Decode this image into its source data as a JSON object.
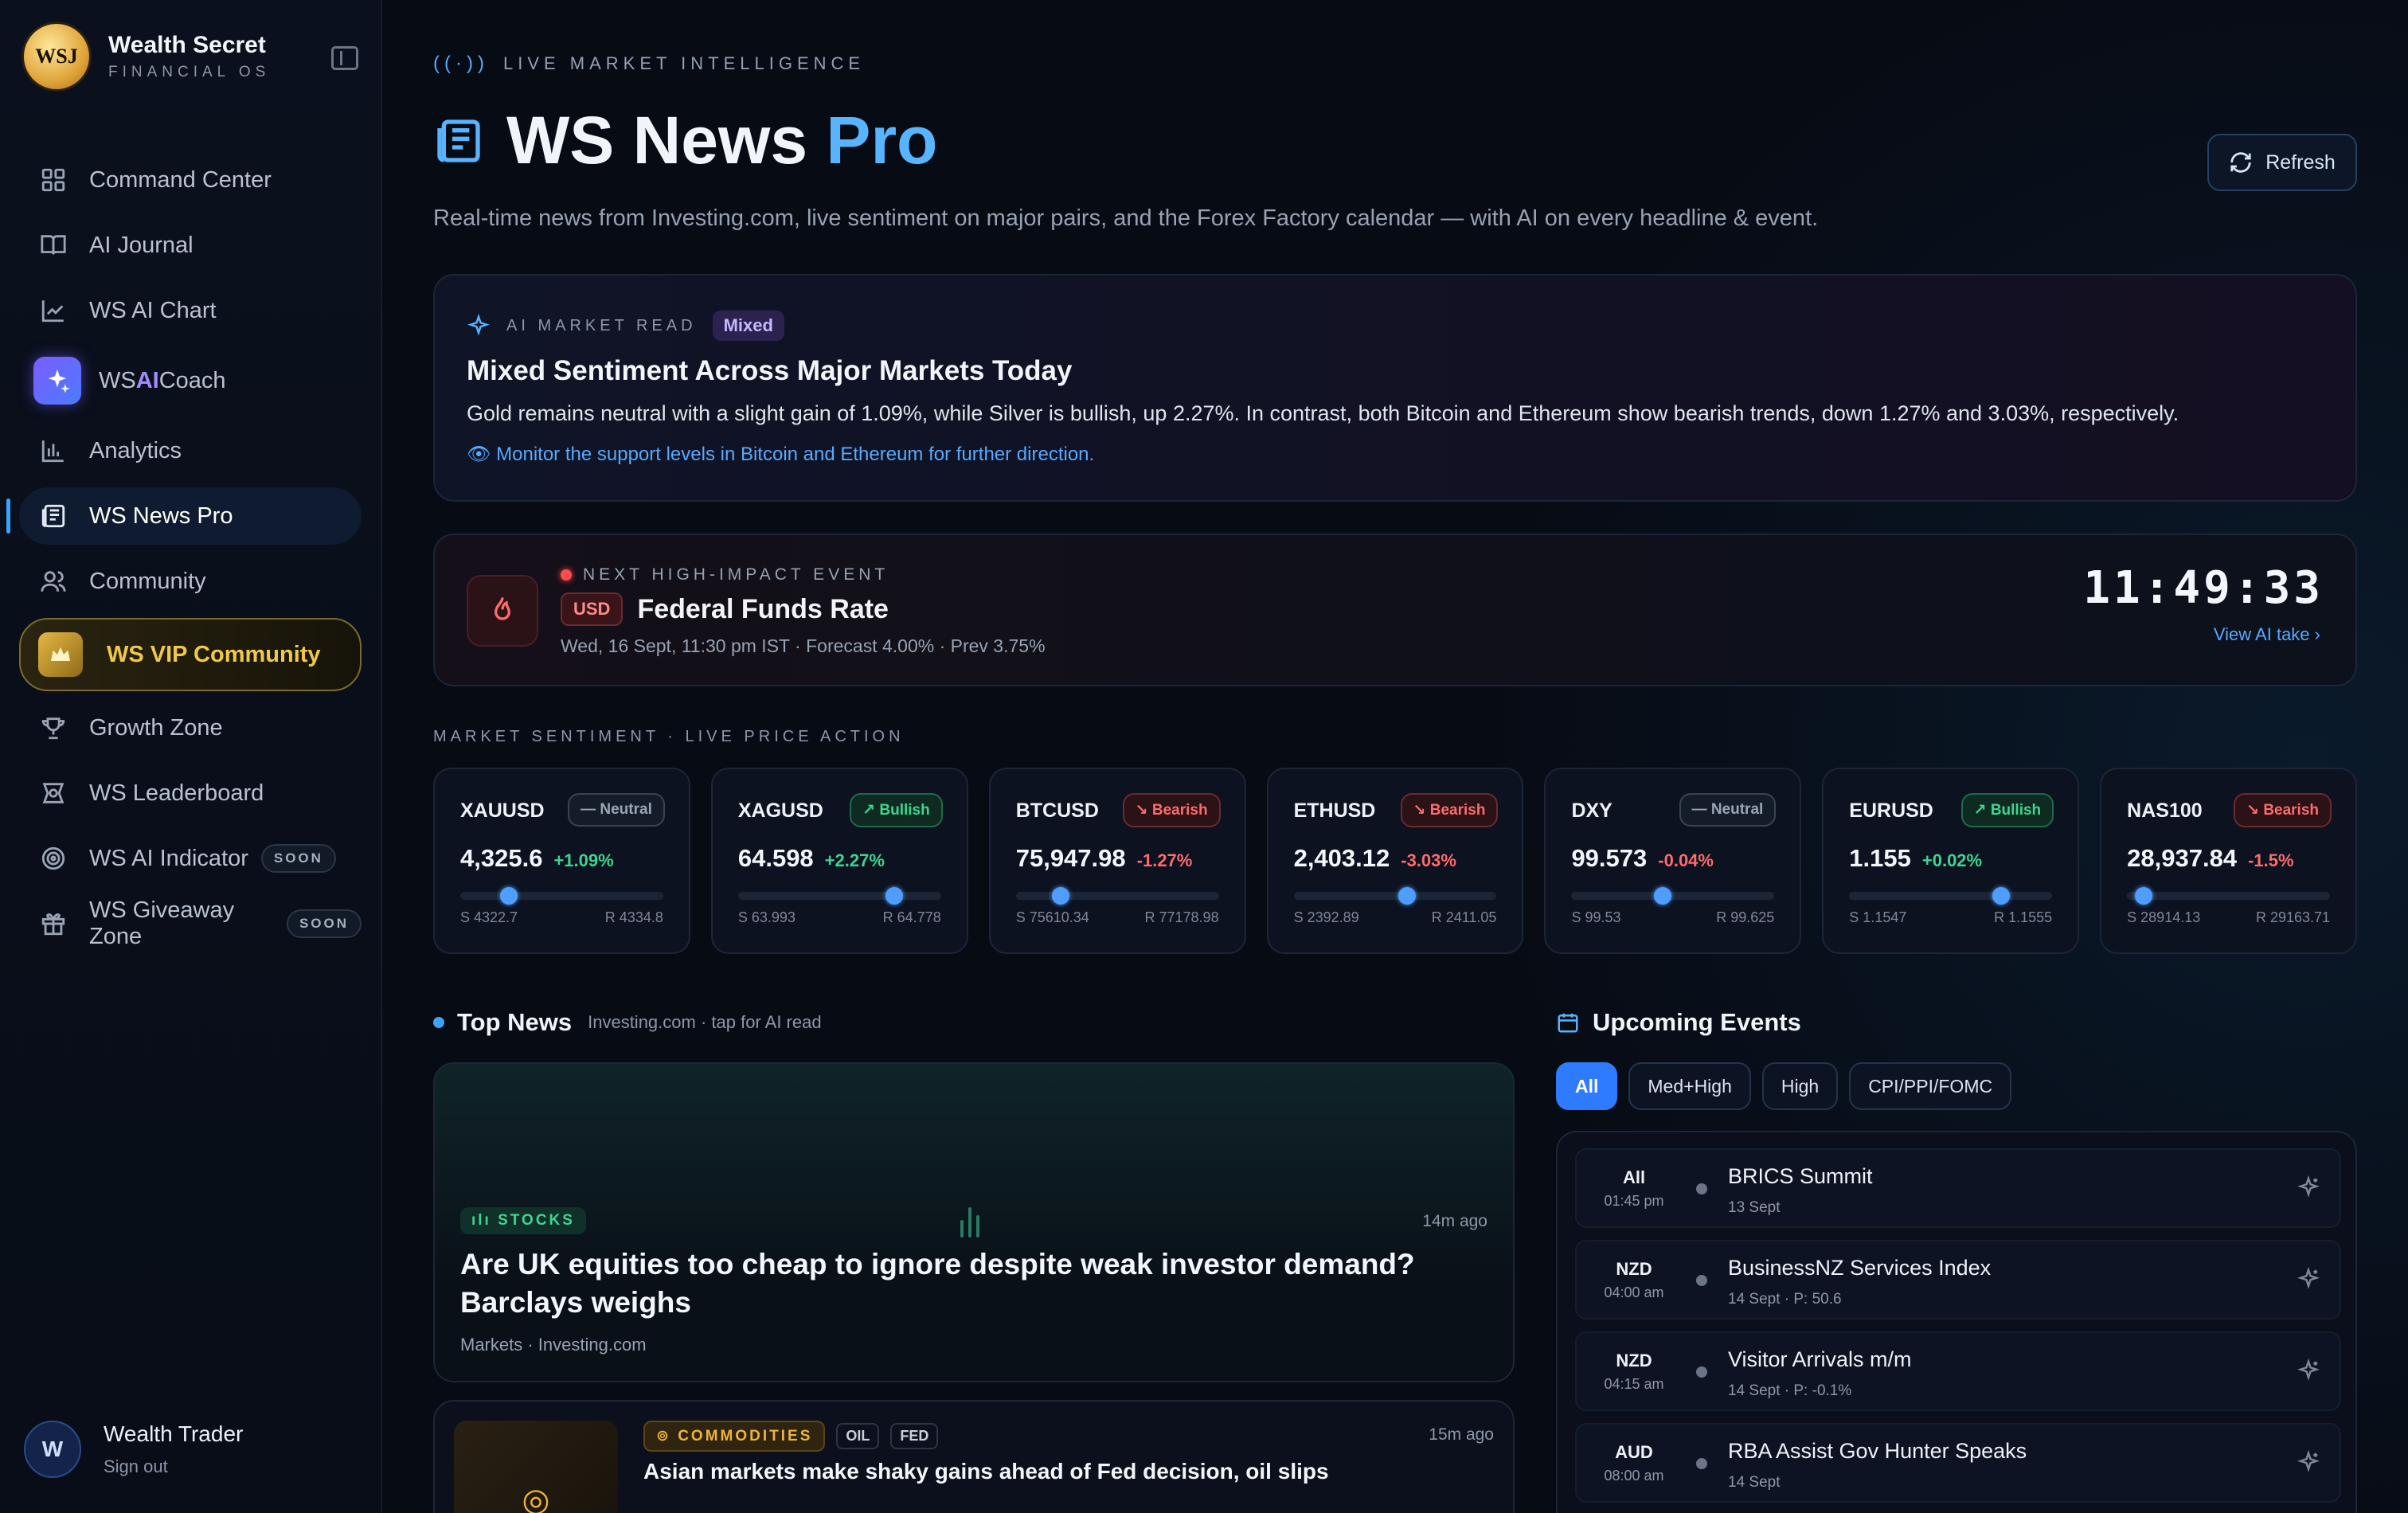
{
  "brand": {
    "name": "Wealth Secret",
    "sub": "FINANCIAL OS",
    "logo_text": "WSJ"
  },
  "nav": [
    {
      "label": "Command Center",
      "icon": "grid-icon"
    },
    {
      "label": "AI Journal",
      "icon": "book-icon"
    },
    {
      "label": "WS AI Chart",
      "icon": "chart-line-icon"
    },
    {
      "label_pre": "WS ",
      "label_ai": "AI",
      "label_post": " Coach",
      "icon": "sparkle-icon"
    },
    {
      "label": "Analytics",
      "icon": "bar-chart-icon"
    },
    {
      "label": "WS News Pro",
      "icon": "newspaper-icon"
    },
    {
      "label": "Community",
      "icon": "users-icon"
    },
    {
      "label": "WS VIP Community",
      "icon": "crown-icon"
    },
    {
      "label": "Growth Zone",
      "icon": "trophy-icon"
    },
    {
      "label": "WS Leaderboard",
      "icon": "badge-icon"
    },
    {
      "label": "WS AI Indicator",
      "icon": "target-icon",
      "badge": "SOON"
    },
    {
      "label": "WS Giveaway Zone",
      "icon": "gift-icon",
      "badge": "SOON"
    }
  ],
  "user": {
    "initial": "W",
    "name": "Wealth Trader",
    "signout": "Sign out"
  },
  "header": {
    "eyebrow": "LIVE MARKET INTELLIGENCE",
    "title_pre": "WS News ",
    "title_accent": "Pro",
    "subtitle": "Real-time news from Investing.com, live sentiment on major pairs, and the Forex Factory calendar — with AI on every headline & event.",
    "refresh": "Refresh"
  },
  "ai_read": {
    "label": "AI MARKET READ",
    "mood": "Mixed",
    "headline": "Mixed Sentiment Across Major Markets Today",
    "body": "Gold remains neutral with a slight gain of 1.09%, while Silver is bullish, up 2.27%. In contrast, both Bitcoin and Ethereum show bearish trends, down 1.27% and 3.03%, respectively.",
    "tip": "Monitor the support levels in Bitcoin and Ethereum for further direction."
  },
  "next_event": {
    "label": "NEXT HIGH-IMPACT EVENT",
    "currency": "USD",
    "name": "Federal Funds Rate",
    "meta": "Wed, 16 Sept, 11:30 pm IST · Forecast 4.00% · Prev 3.75%",
    "countdown": "11:49:33",
    "view_take": "View AI take"
  },
  "sentiment_label": "MARKET SENTIMENT · LIVE PRICE ACTION",
  "tickers": [
    {
      "symbol": "XAUUSD",
      "badge": "Neutral",
      "kind": "neutral",
      "price": "4,325.6",
      "change": "+1.09%",
      "dir": "up",
      "position": 0.24,
      "support": "S 4322.7",
      "resistance": "R 4334.8"
    },
    {
      "symbol": "XAGUSD",
      "badge": "Bullish",
      "kind": "bull",
      "price": "64.598",
      "change": "+2.27%",
      "dir": "up",
      "position": 0.77,
      "support": "S 63.993",
      "resistance": "R 64.778"
    },
    {
      "symbol": "BTCUSD",
      "badge": "Bearish",
      "kind": "bear",
      "price": "75,947.98",
      "change": "-1.27%",
      "dir": "down",
      "position": 0.22,
      "support": "S 75610.34",
      "resistance": "R 77178.98"
    },
    {
      "symbol": "ETHUSD",
      "badge": "Bearish",
      "kind": "bear",
      "price": "2,403.12",
      "change": "-3.03%",
      "dir": "down",
      "position": 0.56,
      "support": "S 2392.89",
      "resistance": "R 2411.05"
    },
    {
      "symbol": "DXY",
      "badge": "Neutral",
      "kind": "neutral",
      "price": "99.573",
      "change": "-0.04%",
      "dir": "down",
      "position": 0.45,
      "support": "S 99.53",
      "resistance": "R 99.625"
    },
    {
      "symbol": "EURUSD",
      "badge": "Bullish",
      "kind": "bull",
      "price": "1.155",
      "change": "+0.02%",
      "dir": "up",
      "position": 0.75,
      "support": "S 1.1547",
      "resistance": "R 1.1555"
    },
    {
      "symbol": "NAS100",
      "badge": "Bearish",
      "kind": "bear",
      "price": "28,937.84",
      "change": "-1.5%",
      "dir": "down",
      "position": 0.08,
      "support": "S 28914.13",
      "resistance": "R 29163.71"
    }
  ],
  "top_news": {
    "title": "Top News",
    "source": "Investing.com · tap for AI read",
    "items": [
      {
        "category": "STOCKS",
        "time": "14m ago",
        "title": "Are UK equities too cheap to ignore despite weak investor demand? Barclays weighs",
        "meta": "Markets · Investing.com"
      },
      {
        "category": "COMMODITIES",
        "tags": [
          "OIL",
          "FED"
        ],
        "time": "15m ago",
        "title": "Asian markets make shaky gains ahead of Fed decision, oil slips"
      }
    ]
  },
  "upcoming": {
    "title": "Upcoming Events",
    "filters": [
      "All",
      "Med+High",
      "High",
      "CPI/PPI/FOMC"
    ],
    "selected_filter": "All",
    "events": [
      {
        "currency": "All",
        "time": "01:45 pm",
        "name": "BRICS Summit",
        "detail": "13 Sept"
      },
      {
        "currency": "NZD",
        "time": "04:00 am",
        "name": "BusinessNZ Services Index",
        "detail": "14 Sept · P: 50.6"
      },
      {
        "currency": "NZD",
        "time": "04:15 am",
        "name": "Visitor Arrivals m/m",
        "detail": "14 Sept · P: -0.1%"
      },
      {
        "currency": "AUD",
        "time": "08:00 am",
        "name": "RBA Assist Gov Hunter Speaks",
        "detail": "14 Sept"
      }
    ]
  },
  "colors": {
    "accent": "#59b4ff",
    "bull": "#3ed68f",
    "bear": "#ff6b6b",
    "gold": "#f0c94a"
  }
}
